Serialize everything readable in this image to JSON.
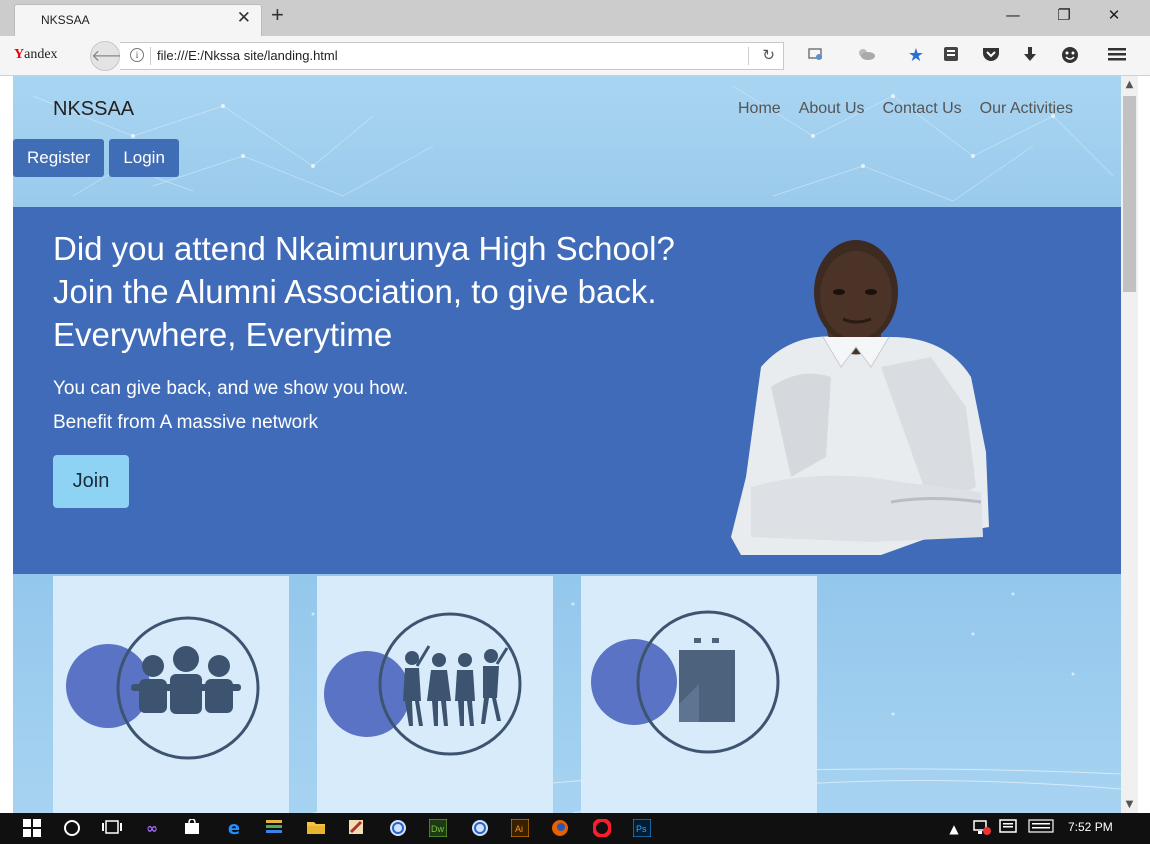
{
  "browser": {
    "tab_title": "NKSSAA",
    "yandex_logo": "Yandex",
    "url": "file:///E:/Nkssa site/landing.html"
  },
  "site": {
    "brand": "NKSSAA",
    "nav": [
      "Home",
      "About Us",
      "Contact Us",
      "Our Activities"
    ],
    "register_label": "Register",
    "login_label": "Login"
  },
  "hero": {
    "headline_lines": [
      "Did you attend Nkaimurunya High School?",
      "Join the Alumni Association, to give back.",
      "Everywhere, Everytime"
    ],
    "sub_lines": [
      "You can give back, and we show you how.",
      "Benefit from A massive network"
    ],
    "join_label": "Join"
  },
  "cards": [
    {
      "icon": "group-hug-icon"
    },
    {
      "icon": "celebrating-friends-icon"
    },
    {
      "icon": "clipboard-icon"
    }
  ],
  "taskbar": {
    "clock": "7:52 PM"
  },
  "colors": {
    "hero_bg": "#3f6bb8",
    "header_bg": "#a9d5f2",
    "button_bg": "#3f6db6",
    "join_bg": "#8fd3f4",
    "card_bg": "#d7ebfa",
    "circle_fill": "#5a73c4"
  }
}
